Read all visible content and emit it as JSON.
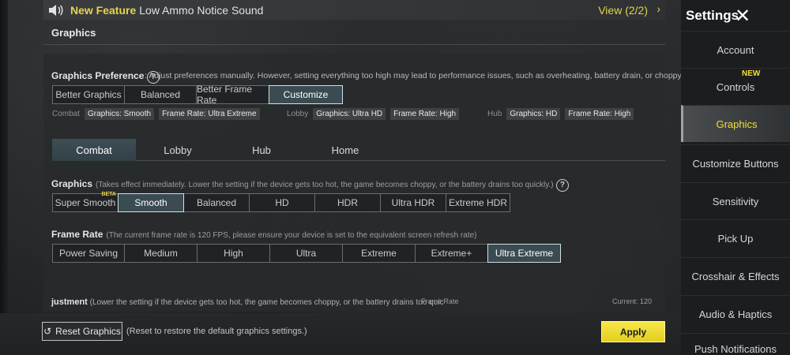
{
  "notice": {
    "icon": "speaker-icon",
    "label_feature": "New Feature",
    "label_text": "Low Ammo Notice Sound",
    "view": "View (2/2)",
    "chevron": "›"
  },
  "section_title": "Graphics",
  "preference": {
    "title": "Graphics Preference",
    "help": "?",
    "desc": ": Adjust preferences manually. However, setting everything too high may lead to performance issues, such as overheating, battery drain, or choppy game",
    "options": [
      "Better Graphics",
      "Balanced",
      "Better Frame Rate",
      "Customize"
    ],
    "selected": "Customize"
  },
  "summary": {
    "combat": {
      "key": "Combat",
      "graphics": "Graphics: Smooth",
      "frame_rate": "Frame Rate: Ultra Extreme"
    },
    "lobby": {
      "key": "Lobby",
      "graphics": "Graphics: Ultra HD",
      "frame_rate": "Frame Rate: High"
    },
    "hub": {
      "key": "Hub",
      "graphics": "Graphics: HD",
      "frame_rate": "Frame Rate: High"
    }
  },
  "tabs": [
    "Combat",
    "Lobby",
    "Hub",
    "Home"
  ],
  "selected_tab": "Combat",
  "graphics_row": {
    "title": "Graphics",
    "desc": "(Takes effect immediately. Lower the setting if the device gets too hot, the game becomes choppy, or the battery drains too quickly.)",
    "help": "?",
    "options": [
      "Super Smooth",
      "Smooth",
      "Balanced",
      "HD",
      "HDR",
      "Ultra HDR",
      "Extreme HDR"
    ],
    "beta": "BETA",
    "selected": "Smooth"
  },
  "framerate_row": {
    "title": "Frame Rate",
    "desc": "(The current frame rate is 120 FPS, please ensure your device is set to the equivalent screen refresh rate)",
    "options": [
      "Power Saving",
      "Medium",
      "High",
      "Ultra",
      "Extreme",
      "Extreme+",
      "Ultra Extreme"
    ],
    "selected": "Ultra Extreme"
  },
  "partial_row": {
    "title": "justment",
    "desc": "(Lower the setting if the device gets too hot, the game becomes choppy, or the battery drains too quic",
    "frame_rate": "Frame Rate",
    "current": "Current: 120"
  },
  "bottom": {
    "reset_icon": "↺",
    "reset_label": "Reset Graphics",
    "reset_note": "(Reset to restore the default graphics settings.)",
    "apply_label": "Apply"
  },
  "sidebar": {
    "title": "Settings",
    "close": "✕",
    "new_badge": "NEW",
    "items": [
      "Account",
      "Controls",
      "Graphics",
      "Customize Buttons",
      "Sensitivity",
      "Pick Up",
      "Crosshair & Effects",
      "Audio & Haptics",
      "Push Notifications"
    ],
    "selected": "Graphics"
  },
  "colors": {
    "accent_yellow": "#e5d44f",
    "selected_bg": "#3a4b52",
    "apply_bg": "#f6e84b"
  }
}
